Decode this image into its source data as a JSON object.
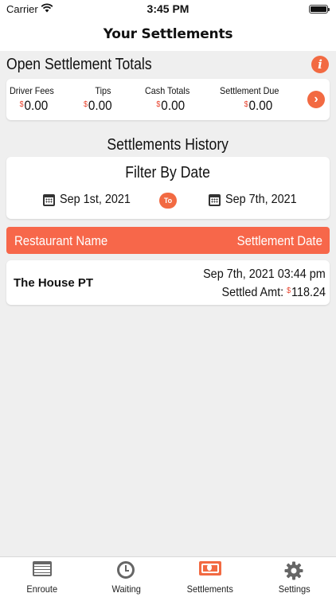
{
  "status_bar": {
    "carrier": "Carrier",
    "time": "3:45 PM"
  },
  "nav": {
    "title": "Your Settlements"
  },
  "open_totals": {
    "title": "Open Settlement Totals",
    "currency_symbol": "$",
    "columns": [
      {
        "label": "Driver Fees",
        "value": "0.00"
      },
      {
        "label": "Tips",
        "value": "0.00"
      },
      {
        "label": "Cash Totals",
        "value": "0.00"
      },
      {
        "label": "Settlement Due",
        "value": "0.00"
      }
    ]
  },
  "history": {
    "title": "Settlements History",
    "filter_title": "Filter By Date",
    "from_date": "Sep 1st, 2021",
    "to_label": "To",
    "to_date": "Sep 7th, 2021"
  },
  "table": {
    "headers": {
      "left": "Restaurant Name",
      "right": "Settlement Date"
    },
    "rows": [
      {
        "name": "The House PT",
        "date": "Sep 7th, 2021 03:44 pm",
        "amount_label": "Settled Amt:",
        "currency_symbol": "$",
        "amount": "118.24"
      }
    ]
  },
  "tabs": [
    {
      "label": "Enroute",
      "icon": "list-icon"
    },
    {
      "label": "Waiting",
      "icon": "clock-icon"
    },
    {
      "label": "Settlements",
      "icon": "money-icon",
      "active": true
    },
    {
      "label": "Settings",
      "icon": "gear-icon"
    }
  ],
  "colors": {
    "accent": "#f26a42",
    "currency": "#e8412b",
    "background": "#efefef"
  }
}
